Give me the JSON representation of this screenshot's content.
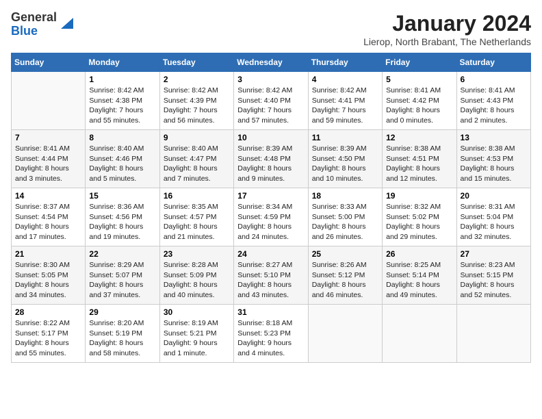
{
  "header": {
    "logo_general": "General",
    "logo_blue": "Blue",
    "month_title": "January 2024",
    "location": "Lierop, North Brabant, The Netherlands"
  },
  "days_of_week": [
    "Sunday",
    "Monday",
    "Tuesday",
    "Wednesday",
    "Thursday",
    "Friday",
    "Saturday"
  ],
  "weeks": [
    [
      {
        "day": "",
        "sunrise": "",
        "sunset": "",
        "daylight": ""
      },
      {
        "day": "1",
        "sunrise": "Sunrise: 8:42 AM",
        "sunset": "Sunset: 4:38 PM",
        "daylight": "Daylight: 7 hours and 55 minutes."
      },
      {
        "day": "2",
        "sunrise": "Sunrise: 8:42 AM",
        "sunset": "Sunset: 4:39 PM",
        "daylight": "Daylight: 7 hours and 56 minutes."
      },
      {
        "day": "3",
        "sunrise": "Sunrise: 8:42 AM",
        "sunset": "Sunset: 4:40 PM",
        "daylight": "Daylight: 7 hours and 57 minutes."
      },
      {
        "day": "4",
        "sunrise": "Sunrise: 8:42 AM",
        "sunset": "Sunset: 4:41 PM",
        "daylight": "Daylight: 7 hours and 59 minutes."
      },
      {
        "day": "5",
        "sunrise": "Sunrise: 8:41 AM",
        "sunset": "Sunset: 4:42 PM",
        "daylight": "Daylight: 8 hours and 0 minutes."
      },
      {
        "day": "6",
        "sunrise": "Sunrise: 8:41 AM",
        "sunset": "Sunset: 4:43 PM",
        "daylight": "Daylight: 8 hours and 2 minutes."
      }
    ],
    [
      {
        "day": "7",
        "sunrise": "Sunrise: 8:41 AM",
        "sunset": "Sunset: 4:44 PM",
        "daylight": "Daylight: 8 hours and 3 minutes."
      },
      {
        "day": "8",
        "sunrise": "Sunrise: 8:40 AM",
        "sunset": "Sunset: 4:46 PM",
        "daylight": "Daylight: 8 hours and 5 minutes."
      },
      {
        "day": "9",
        "sunrise": "Sunrise: 8:40 AM",
        "sunset": "Sunset: 4:47 PM",
        "daylight": "Daylight: 8 hours and 7 minutes."
      },
      {
        "day": "10",
        "sunrise": "Sunrise: 8:39 AM",
        "sunset": "Sunset: 4:48 PM",
        "daylight": "Daylight: 8 hours and 9 minutes."
      },
      {
        "day": "11",
        "sunrise": "Sunrise: 8:39 AM",
        "sunset": "Sunset: 4:50 PM",
        "daylight": "Daylight: 8 hours and 10 minutes."
      },
      {
        "day": "12",
        "sunrise": "Sunrise: 8:38 AM",
        "sunset": "Sunset: 4:51 PM",
        "daylight": "Daylight: 8 hours and 12 minutes."
      },
      {
        "day": "13",
        "sunrise": "Sunrise: 8:38 AM",
        "sunset": "Sunset: 4:53 PM",
        "daylight": "Daylight: 8 hours and 15 minutes."
      }
    ],
    [
      {
        "day": "14",
        "sunrise": "Sunrise: 8:37 AM",
        "sunset": "Sunset: 4:54 PM",
        "daylight": "Daylight: 8 hours and 17 minutes."
      },
      {
        "day": "15",
        "sunrise": "Sunrise: 8:36 AM",
        "sunset": "Sunset: 4:56 PM",
        "daylight": "Daylight: 8 hours and 19 minutes."
      },
      {
        "day": "16",
        "sunrise": "Sunrise: 8:35 AM",
        "sunset": "Sunset: 4:57 PM",
        "daylight": "Daylight: 8 hours and 21 minutes."
      },
      {
        "day": "17",
        "sunrise": "Sunrise: 8:34 AM",
        "sunset": "Sunset: 4:59 PM",
        "daylight": "Daylight: 8 hours and 24 minutes."
      },
      {
        "day": "18",
        "sunrise": "Sunrise: 8:33 AM",
        "sunset": "Sunset: 5:00 PM",
        "daylight": "Daylight: 8 hours and 26 minutes."
      },
      {
        "day": "19",
        "sunrise": "Sunrise: 8:32 AM",
        "sunset": "Sunset: 5:02 PM",
        "daylight": "Daylight: 8 hours and 29 minutes."
      },
      {
        "day": "20",
        "sunrise": "Sunrise: 8:31 AM",
        "sunset": "Sunset: 5:04 PM",
        "daylight": "Daylight: 8 hours and 32 minutes."
      }
    ],
    [
      {
        "day": "21",
        "sunrise": "Sunrise: 8:30 AM",
        "sunset": "Sunset: 5:05 PM",
        "daylight": "Daylight: 8 hours and 34 minutes."
      },
      {
        "day": "22",
        "sunrise": "Sunrise: 8:29 AM",
        "sunset": "Sunset: 5:07 PM",
        "daylight": "Daylight: 8 hours and 37 minutes."
      },
      {
        "day": "23",
        "sunrise": "Sunrise: 8:28 AM",
        "sunset": "Sunset: 5:09 PM",
        "daylight": "Daylight: 8 hours and 40 minutes."
      },
      {
        "day": "24",
        "sunrise": "Sunrise: 8:27 AM",
        "sunset": "Sunset: 5:10 PM",
        "daylight": "Daylight: 8 hours and 43 minutes."
      },
      {
        "day": "25",
        "sunrise": "Sunrise: 8:26 AM",
        "sunset": "Sunset: 5:12 PM",
        "daylight": "Daylight: 8 hours and 46 minutes."
      },
      {
        "day": "26",
        "sunrise": "Sunrise: 8:25 AM",
        "sunset": "Sunset: 5:14 PM",
        "daylight": "Daylight: 8 hours and 49 minutes."
      },
      {
        "day": "27",
        "sunrise": "Sunrise: 8:23 AM",
        "sunset": "Sunset: 5:15 PM",
        "daylight": "Daylight: 8 hours and 52 minutes."
      }
    ],
    [
      {
        "day": "28",
        "sunrise": "Sunrise: 8:22 AM",
        "sunset": "Sunset: 5:17 PM",
        "daylight": "Daylight: 8 hours and 55 minutes."
      },
      {
        "day": "29",
        "sunrise": "Sunrise: 8:20 AM",
        "sunset": "Sunset: 5:19 PM",
        "daylight": "Daylight: 8 hours and 58 minutes."
      },
      {
        "day": "30",
        "sunrise": "Sunrise: 8:19 AM",
        "sunset": "Sunset: 5:21 PM",
        "daylight": "Daylight: 9 hours and 1 minute."
      },
      {
        "day": "31",
        "sunrise": "Sunrise: 8:18 AM",
        "sunset": "Sunset: 5:23 PM",
        "daylight": "Daylight: 9 hours and 4 minutes."
      },
      {
        "day": "",
        "sunrise": "",
        "sunset": "",
        "daylight": ""
      },
      {
        "day": "",
        "sunrise": "",
        "sunset": "",
        "daylight": ""
      },
      {
        "day": "",
        "sunrise": "",
        "sunset": "",
        "daylight": ""
      }
    ]
  ]
}
